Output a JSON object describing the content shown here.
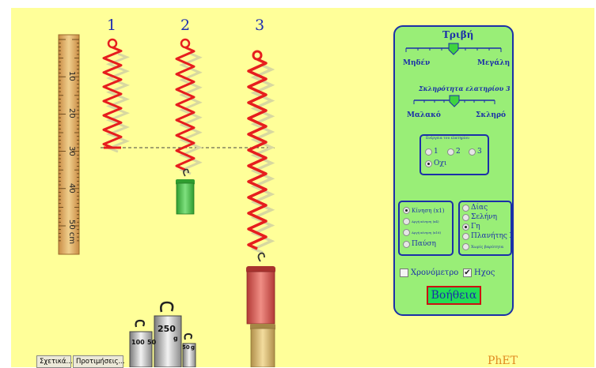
{
  "springs": {
    "labels": [
      "1",
      "2",
      "3"
    ]
  },
  "ruler": {
    "ticks": [
      "10",
      "20",
      "30",
      "40",
      "50 cm"
    ]
  },
  "controls": {
    "friction": {
      "title": "Τριβή",
      "min_label": "Μηδέν",
      "max_label": "Μεγάλη",
      "level": 0.5
    },
    "stiffness": {
      "title": "Σκληρότητα ελατηρίου 3",
      "min_label": "Μαλακό",
      "max_label": "Σκληρό",
      "level": 0.5
    },
    "energy": {
      "title": "Ενέργεια του ελατηρίου",
      "options": [
        "1",
        "2",
        "3",
        "Οχι"
      ],
      "selected": "Οχι"
    },
    "motion": {
      "options": [
        "Κίνηση (x1)",
        "Αργή κίνηση (x4)",
        "Αργή κίνηση (x16)",
        "Παύση"
      ],
      "selected": "Κίνηση (x1)"
    },
    "gravity": {
      "options": [
        "Δίας",
        "Σελήνη",
        "Γη",
        "Πλανήτης Χ",
        "Χωρίς βαρύτητα"
      ],
      "selected": "Γη"
    },
    "stopwatch": {
      "label": "Χρονόμετρο",
      "checked": false
    },
    "sound": {
      "label": "Ηχος",
      "checked": true
    },
    "help_label": "Βοήθεια"
  },
  "weights": {
    "labels": [
      "250",
      "100",
      "50",
      "g",
      "50",
      "g"
    ]
  },
  "logo": "PhET",
  "bottom_buttons": {
    "about": "Σχετικά...",
    "preferences": "Προτιμήσεις..."
  },
  "colors": {
    "background": "#ffff99",
    "panel": "#99ee77",
    "panel_border": "#1b2fa8",
    "spring": "#e61e1e",
    "mass_green": "#44cc44",
    "mass_red": "#d9534f",
    "mass_gold": "#d4b56a",
    "help_button": "#22dd55"
  }
}
